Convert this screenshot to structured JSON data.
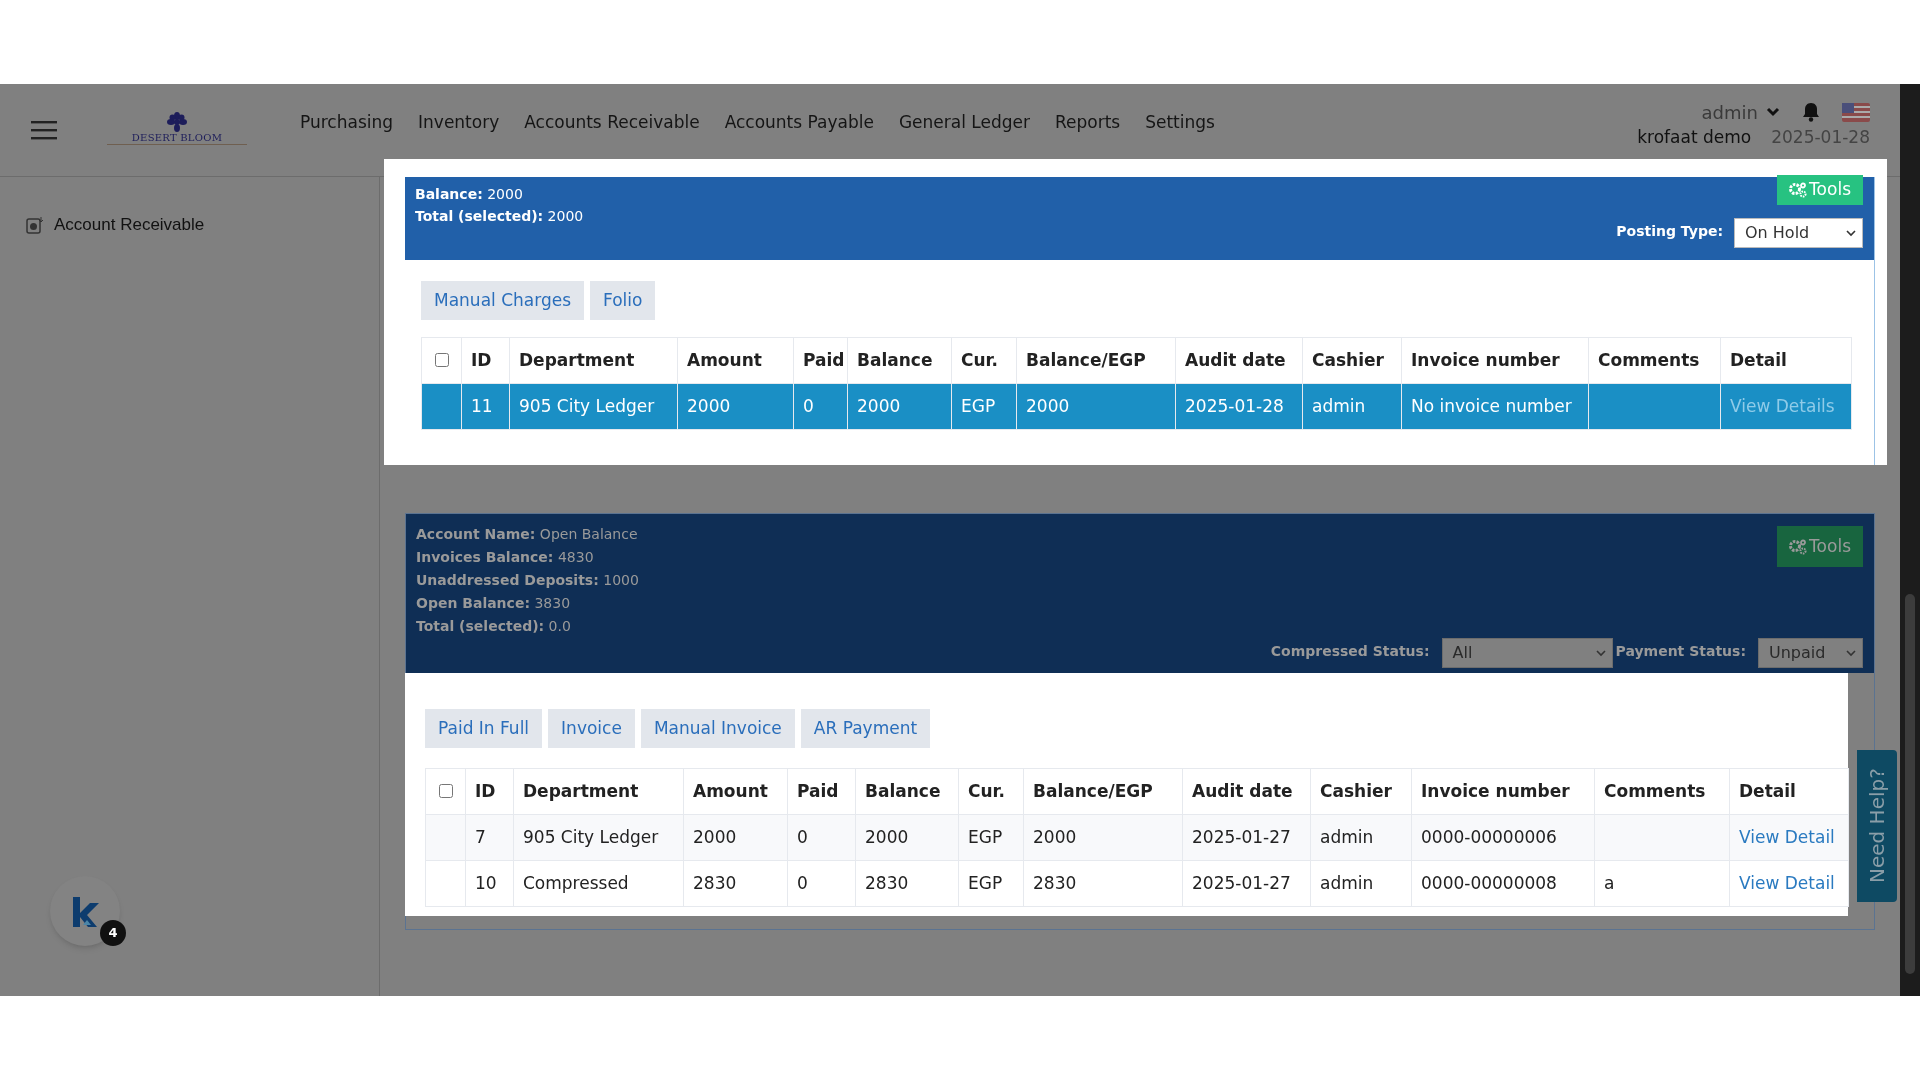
{
  "header": {
    "brand": "DESERT BLOOM",
    "nav": [
      "Purchasing",
      "Inventory",
      "Accounts Receivable",
      "Accounts Payable",
      "General Ledger",
      "Reports",
      "Settings"
    ],
    "user": "admin",
    "company": "krofaat demo",
    "date": "2025-01-28"
  },
  "sidebar": {
    "items": [
      {
        "label": "Account Receivable"
      }
    ]
  },
  "panels": [
    {
      "dimmed": false,
      "summary": [
        {
          "label": "Balance:",
          "value": "2000"
        },
        {
          "label": "Total (selected):",
          "value": "2000"
        }
      ],
      "tools": "Tools",
      "filters": [
        {
          "label": "Posting Type:",
          "value": "On Hold"
        }
      ],
      "tabs": [
        "Manual Charges",
        "Folio"
      ],
      "select_all": {
        "checked": false
      },
      "columns": [
        "ID",
        "Department",
        "Amount",
        "Paid",
        "Balance",
        "Cur.",
        "Balance/EGP",
        "Audit date",
        "Cashier",
        "Invoice number",
        "Comments",
        "Detail"
      ],
      "rows": [
        {
          "selected": true,
          "cells": [
            "11",
            "905 City Ledger",
            "2000",
            "0",
            "2000",
            "EGP",
            "2000",
            "2025-01-28",
            "admin",
            "No invoice number",
            ""
          ],
          "link": "View Details"
        }
      ]
    },
    {
      "dimmed": true,
      "summary": [
        {
          "label": "Account Name:",
          "value": "Open Balance"
        },
        {
          "label": "Invoices Balance:",
          "value": "4830"
        },
        {
          "label": "Unaddressed Deposits:",
          "value": "1000"
        },
        {
          "label": "Open Balance:",
          "value": "3830"
        },
        {
          "label": "Total (selected):",
          "value": "0.0"
        }
      ],
      "tools": "Tools",
      "filters": [
        {
          "label": "Compressed Status:",
          "value": "All"
        },
        {
          "label": "Payment Status:",
          "value": "Unpaid"
        }
      ],
      "tabs": [
        "Paid In Full",
        "Invoice",
        "Manual Invoice",
        "AR Payment"
      ],
      "select_all": {
        "checked": false
      },
      "columns": [
        "ID",
        "Department",
        "Amount",
        "Paid",
        "Balance",
        "Cur.",
        "Balance/EGP",
        "Audit date",
        "Cashier",
        "Invoice number",
        "Comments",
        "Detail"
      ],
      "rows": [
        {
          "selected": false,
          "cells": [
            "7",
            "905 City Ledger",
            "2000",
            "0",
            "2000",
            "EGP",
            "2000",
            "2025-01-27",
            "admin",
            "0000-00000006",
            ""
          ],
          "link": "View Detail"
        },
        {
          "selected": false,
          "cells": [
            "10",
            "Compressed",
            "2830",
            "0",
            "2830",
            "EGP",
            "2830",
            "2025-01-27",
            "admin",
            "0000-00000008",
            "a"
          ],
          "link": "View Detail"
        }
      ]
    }
  ],
  "help_tab": "Need Help?",
  "chat_badge": "4"
}
